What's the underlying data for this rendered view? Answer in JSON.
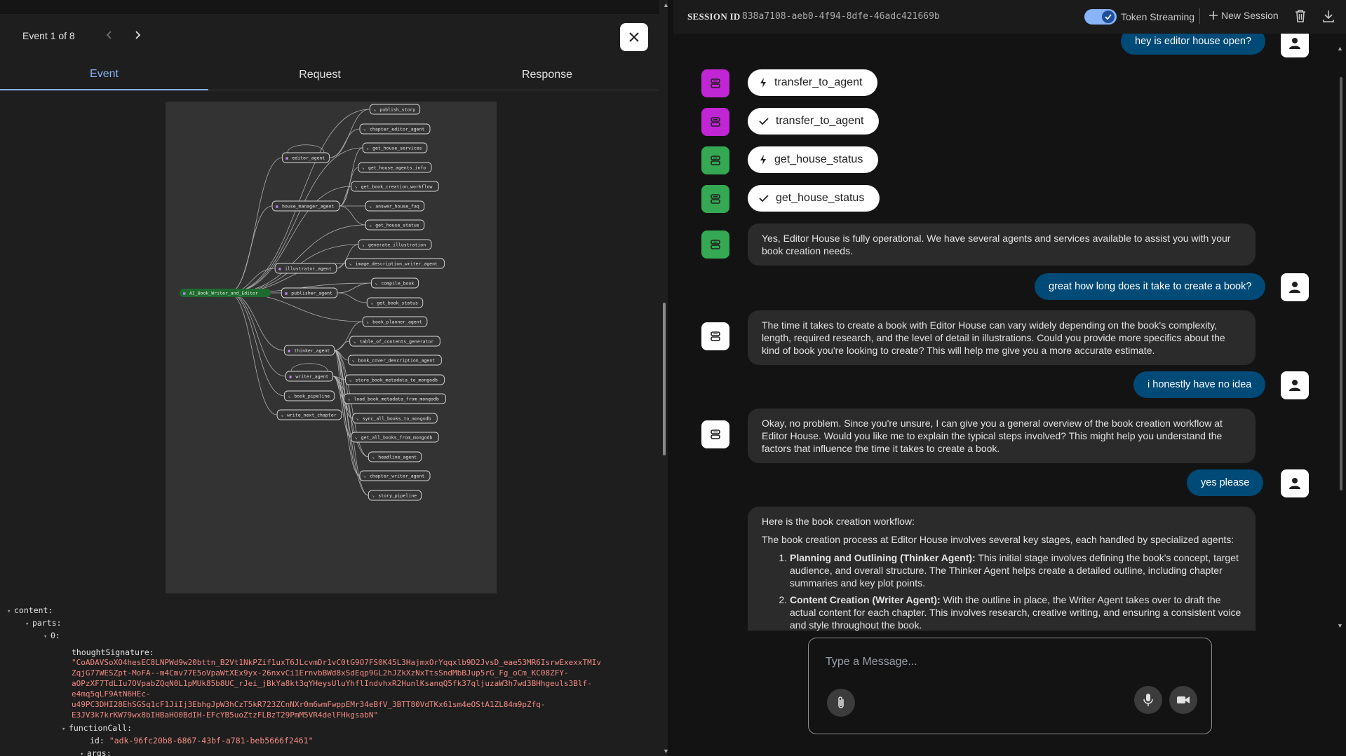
{
  "event_panel": {
    "counter": "Event 1 of 8",
    "tabs": [
      "Event",
      "Request",
      "Response"
    ],
    "graph": {
      "root": "AI_Book_Writer_and_Editor",
      "agents": [
        "editor_agent",
        "house_manager_agent",
        "illustrator_agent",
        "publisher_agent",
        "thinker_agent",
        "writer_agent"
      ],
      "tools": [
        "publish_story",
        "chapter_editor_agent",
        "get_house_services",
        "get_house_agents_info",
        "get_book_creation_workflow",
        "answer_house_faq",
        "get_house_status",
        "generate_illustration",
        "image_description_writer_agent",
        "compile_book",
        "get_book_status",
        "book_planner_agent",
        "table_of_contents_generator",
        "book_cover_description_agent",
        "store_book_metadata_to_mongodb",
        "load_book_metadata_from_mongodb",
        "sync_all_books_to_mongodb",
        "get_all_books_from_mongodb",
        "headline_agent",
        "chapter_writer_agent",
        "story_pipeline",
        "book_pipeline",
        "write_next_chapter"
      ]
    },
    "json": {
      "content_key": "content:",
      "parts_key": "parts:",
      "index_key": "0:",
      "thought_key": "thoughtSignature:",
      "thought_lines": [
        "\"CoADAVSoXO4hesEC8LNPWd9w20bttn_B2Vt1NkPZif1uxT6JLcvmDr1vC0tG9O7FS0K45L3HajmxOrYqqxlb9D2JvsD_eae53MR6IsrwExexxTMIv",
        "ZqjG77WESZpt-MoFA--m4Cmv77E5oVpaWtXEx9yx-26nxvCi1ErnvbBWd8xSdEqp9GL2hJZkXzNxTtsSndMbBJup5rG_Fg_oCm_KC08ZFY-",
        "aOPzXF7TdLIu7OVpabZQqN0L1pMUk85b8UC_rJei_jBkYa8kt3qYHeysUluYhflIndvhxR2HunlKsanqQ5fk37qljuzaW3h7wd3BHhgeuls3Blf-",
        "e4mq5qLF9AtN6HEc-",
        "u49PC3DHI28EhSGSq1cF1JiIj3EbhgJpW3hCzT5kR723ZCnNXr0m6wmFwppEMr34eBfV_3BTT80VdTKx61sm4eOStA1ZL84m9pZfq-",
        "E3JV3k7krKW79wx8bIHBaHO0BdIH-EFcYB5uoZtzFLBzT29PmM5VR4delFHkgsabN\""
      ],
      "function_key": "functionCall:",
      "id_key": "id:",
      "id_value": "\"adk-96fc20b8-6867-43bf-a781-beb5666f2461\"",
      "args_key": "args:"
    }
  },
  "session": {
    "label": "SESSION ID",
    "id": "838a7108-aeb0-4f94-8dfe-46adc421669b",
    "token_streaming": "Token Streaming",
    "new_session": "New Session"
  },
  "chat": {
    "msg0": "hey is editor house open?",
    "fn1": "transfer_to_agent",
    "fn2": "transfer_to_agent",
    "fn3": "get_house_status",
    "fn4": "get_house_status",
    "bot1": "Yes, Editor House is fully operational. We have several agents and services available to assist you with your book creation needs.",
    "user2": "great how long does it take to create a book?",
    "bot2": "The time it takes to create a book with Editor House can vary widely depending on the book's complexity, length, required research, and the level of detail in illustrations. Could you provide more specifics about the kind of book you're looking to create? This will help me give you a more accurate estimate.",
    "user3": "i honestly have no idea",
    "bot3": "Okay, no problem. Since you're unsure, I can give you a general overview of the book creation workflow at Editor House. Would you like me to explain the typical steps involved? This might help you understand the factors that influence the time it takes to create a book.",
    "user4": "yes please",
    "bot4_p1": "Here is the book creation workflow:",
    "bot4_p2": "The book creation process at Editor House involves several key stages, each handled by specialized agents:",
    "bot4_li1_title": "Planning and Outlining (Thinker Agent):",
    "bot4_li1_text": " This initial stage involves defining the book's concept, target audience, and overall structure. The Thinker Agent helps create a detailed outline, including chapter summaries and key plot points.",
    "bot4_li2_title": "Content Creation (Writer Agent):",
    "bot4_li2_text": " With the outline in place, the Writer Agent takes over to draft the actual content for each chapter. This involves research, creative writing, and ensuring a consistent voice and style throughout the book."
  },
  "input": {
    "placeholder": "Type a Message..."
  },
  "colors": {
    "accent": "#8ab4f8",
    "agent_purple": "#c026d3",
    "agent_green": "#34a853",
    "user_bubble": "#004a77",
    "root_node": "#1e6b2e"
  }
}
